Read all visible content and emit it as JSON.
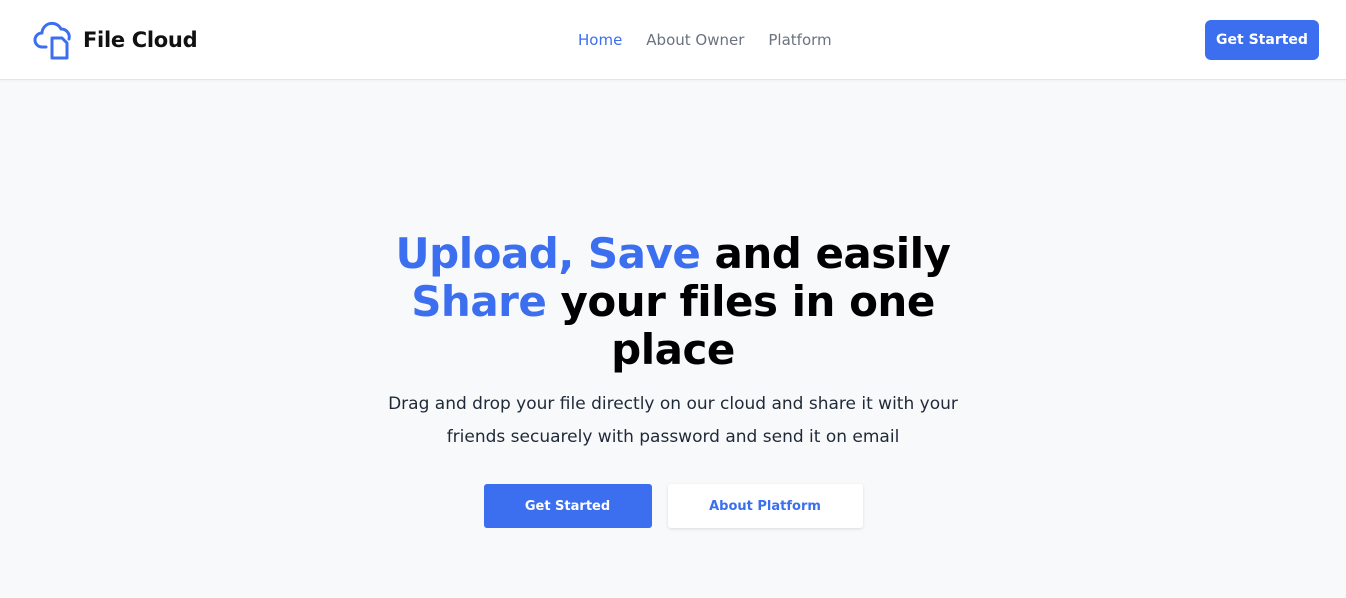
{
  "brand": {
    "name": "File Cloud",
    "icon": "cloud-file-icon",
    "accent_color": "#3b6ff0"
  },
  "nav": {
    "items": [
      {
        "label": "Home",
        "active": true
      },
      {
        "label": "About Owner",
        "active": false
      },
      {
        "label": "Platform",
        "active": false
      }
    ]
  },
  "header": {
    "cta_label": "Get Started"
  },
  "hero": {
    "title_highlight_1": "Upload, Save",
    "title_plain_1": " and easily ",
    "title_highlight_2": "Share",
    "title_plain_2": " your files in one place",
    "subtitle": "Drag and drop your file directly on our cloud and share it with your friends secuarely with password and send it on email",
    "primary_button": "Get Started",
    "secondary_button": "About Platform"
  }
}
